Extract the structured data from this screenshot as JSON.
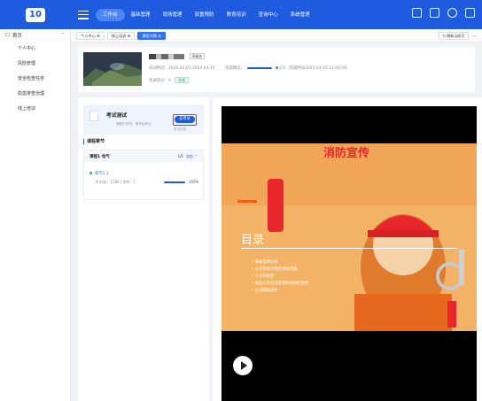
{
  "header": {
    "logo": "10",
    "nav": [
      "工作台",
      "基础管理",
      "现场管理",
      "双重预防",
      "教育培训",
      "查询中心",
      "系统管理"
    ],
    "active_nav": 0
  },
  "sidebar": {
    "head": "首页",
    "items": [
      "个人中心",
      "风险管理",
      "安全检查任务",
      "隐患排查治理",
      "线上培训"
    ]
  },
  "tabs": [
    "个人中心 ⊗",
    "线上培训 ⊗",
    "课程详情 ⊗"
  ],
  "tab_active": 2,
  "refresh_label": "刷新当前页",
  "more_label": "···",
  "course_info": {
    "type_tag": "四级技",
    "time_label": "培训时间：2024-03-07-2024-03-15",
    "progress_label": "完成情况：",
    "progress_fraction": 1.0,
    "progress_text": "1/1（完成时间2025-03-10 11:05:59）",
    "score_label": "考试得分：0",
    "pass_tag": "及格"
  },
  "exam": {
    "title": "考试测试",
    "subtitle": "课程已学完，请开始考试",
    "button": "去考试",
    "record": "考试记录"
  },
  "section_title": "课程章节",
  "course": {
    "name": "课程1  电气",
    "count": "1/1",
    "collapse": "收起 ⌃",
    "chapter": "章节1.1",
    "meta": "⏱ 时长：1180 | 学时：1",
    "progress_fraction": 1.0,
    "percent": "100%"
  },
  "video": {
    "top_text": "消防宣传",
    "slide_title": "目录",
    "items": [
      "事故案例分享",
      "火灾的危险性及预防措施",
      "火灾的报警",
      "初起火灾应对及消防器材的使用",
      "火灾疏散逃生"
    ]
  },
  "colors": {
    "brand": "#1f5bde",
    "exam_btn_border": "#e8272d",
    "pass_green": "#2bb24c"
  }
}
